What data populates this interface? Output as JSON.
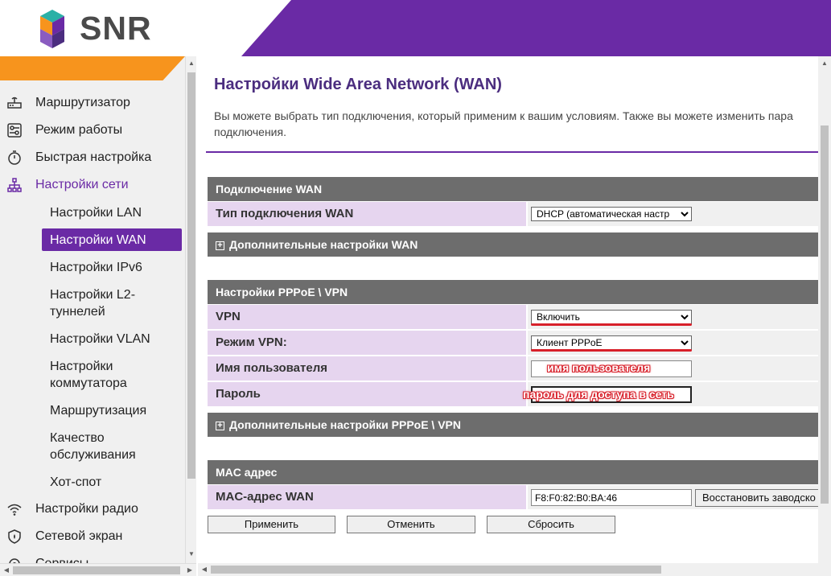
{
  "header": {
    "brand": "SNR",
    "colors": {
      "purple": "#6a2aa5",
      "orange": "#f7941d"
    }
  },
  "sidebar": {
    "items": [
      {
        "label": "Маршрутизатор",
        "icon": "router-icon"
      },
      {
        "label": "Режим работы",
        "icon": "sliders-icon"
      },
      {
        "label": "Быстрая настройка",
        "icon": "stopwatch-icon"
      },
      {
        "label": "Настройки сети",
        "icon": "network-icon"
      }
    ],
    "subitems": [
      "Настройки LAN",
      "Настройки WAN",
      "Настройки IPv6",
      "Настройки L2-туннелей",
      "Настройки VLAN",
      "Настройки коммутатора",
      "Маршрутизация",
      "Качество обслуживания",
      "Хот-спот"
    ],
    "bottom_items": [
      {
        "label": "Настройки радио",
        "icon": "wifi-icon"
      },
      {
        "label": "Сетевой экран",
        "icon": "shield-icon"
      },
      {
        "label": "Сервисы",
        "icon": "services-icon"
      }
    ]
  },
  "page": {
    "title": "Настройки Wide Area Network (WAN)",
    "description": "Вы можете выбрать тип подключения, который применим к вашим условиям. Также вы можете изменить пара подключения."
  },
  "wan": {
    "section": "Подключение WAN",
    "type_label": "Тип подключения WAN",
    "type_value": "DHCP (автоматическая настр",
    "advanced": "Дополнительные настройки WAN"
  },
  "pppoe": {
    "section": "Настройки PPPoE \\ VPN",
    "vpn_label": "VPN",
    "vpn_value": "Включить",
    "mode_label": "Режим VPN:",
    "mode_value": "Клиент PPPoE",
    "user_label": "Имя пользователя",
    "user_annotation": "имя пользователя",
    "pass_label": "Пароль",
    "pass_annotation": "пароль для доступа в сеть",
    "advanced": "Дополнительные настройки PPPoE \\ VPN"
  },
  "mac": {
    "section": "MAC адрес",
    "label": "MAC-адрес WAN",
    "value": "F8:F0:82:B0:BA:46",
    "restore": "Восстановить заводско"
  },
  "actions": {
    "apply": "Применить",
    "cancel": "Отменить",
    "reset": "Сбросить"
  }
}
